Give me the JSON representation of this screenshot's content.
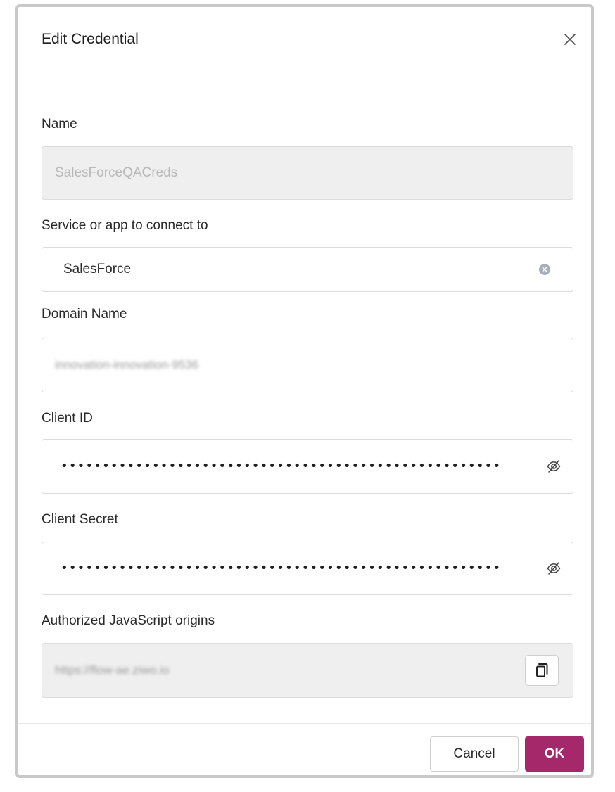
{
  "dialog": {
    "title": "Edit Credential",
    "close_icon": "close-icon"
  },
  "fields": {
    "name": {
      "label": "Name",
      "value": "SalesForceQACreds"
    },
    "service": {
      "label": "Service or app to connect to",
      "value": "SalesForce",
      "clear_icon": "clear-circle-icon"
    },
    "domain": {
      "label": "Domain Name",
      "value": "innovation-innovation-9536"
    },
    "client_id": {
      "label": "Client ID",
      "masked_value": "•••••••••••••••••••••••••••••••••••••••••••••••••••••",
      "toggle_icon": "eye-slash-icon"
    },
    "client_secret": {
      "label": "Client Secret",
      "masked_value": "•••••••••••••••••••••••••••••••••••••••••••••••••••••",
      "toggle_icon": "eye-slash-icon"
    },
    "origins": {
      "label": "Authorized JavaScript origins",
      "value": "https://flow-ae.ziwo.io",
      "copy_icon": "copy-icon"
    }
  },
  "footer": {
    "cancel_label": "Cancel",
    "ok_label": "OK"
  },
  "colors": {
    "primary": "#a4286a",
    "disabled_bg": "#efefef",
    "border": "#dcdcdc"
  }
}
